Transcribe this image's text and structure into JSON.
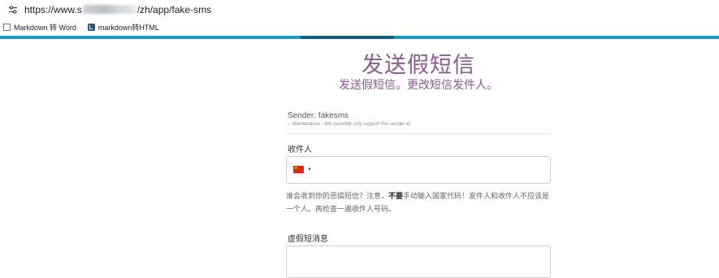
{
  "browser": {
    "url_prefix": "https://www.s",
    "url_suffix": "/zh/app/fake-sms",
    "site_info_icon": "tune-icon",
    "bookmarks": [
      {
        "label": "Markdown 转 Word",
        "icon": "document-icon"
      },
      {
        "label": "markdown转HTML",
        "icon": "markdown-icon"
      }
    ]
  },
  "page": {
    "title": "发送假短信",
    "subtitle": "发送假短信。更改短信发件人。",
    "accent_color": "#8a5a93",
    "stripe_color": "#1a9bc4"
  },
  "form": {
    "sender_label": "Sender: fakesms",
    "sender_note": "-- Maintenance - We currently only support this sender id",
    "recipient_label": "收件人",
    "country_flag": "china-flag-icon",
    "hint_before": "谁会收到你的恶搞短信？注意，",
    "hint_bold": "不要",
    "hint_after": "手动输入国家代码！发件人和收件人不应该是一个人。再检查一遍收件人号码。",
    "message_label": "虚假短消息"
  }
}
